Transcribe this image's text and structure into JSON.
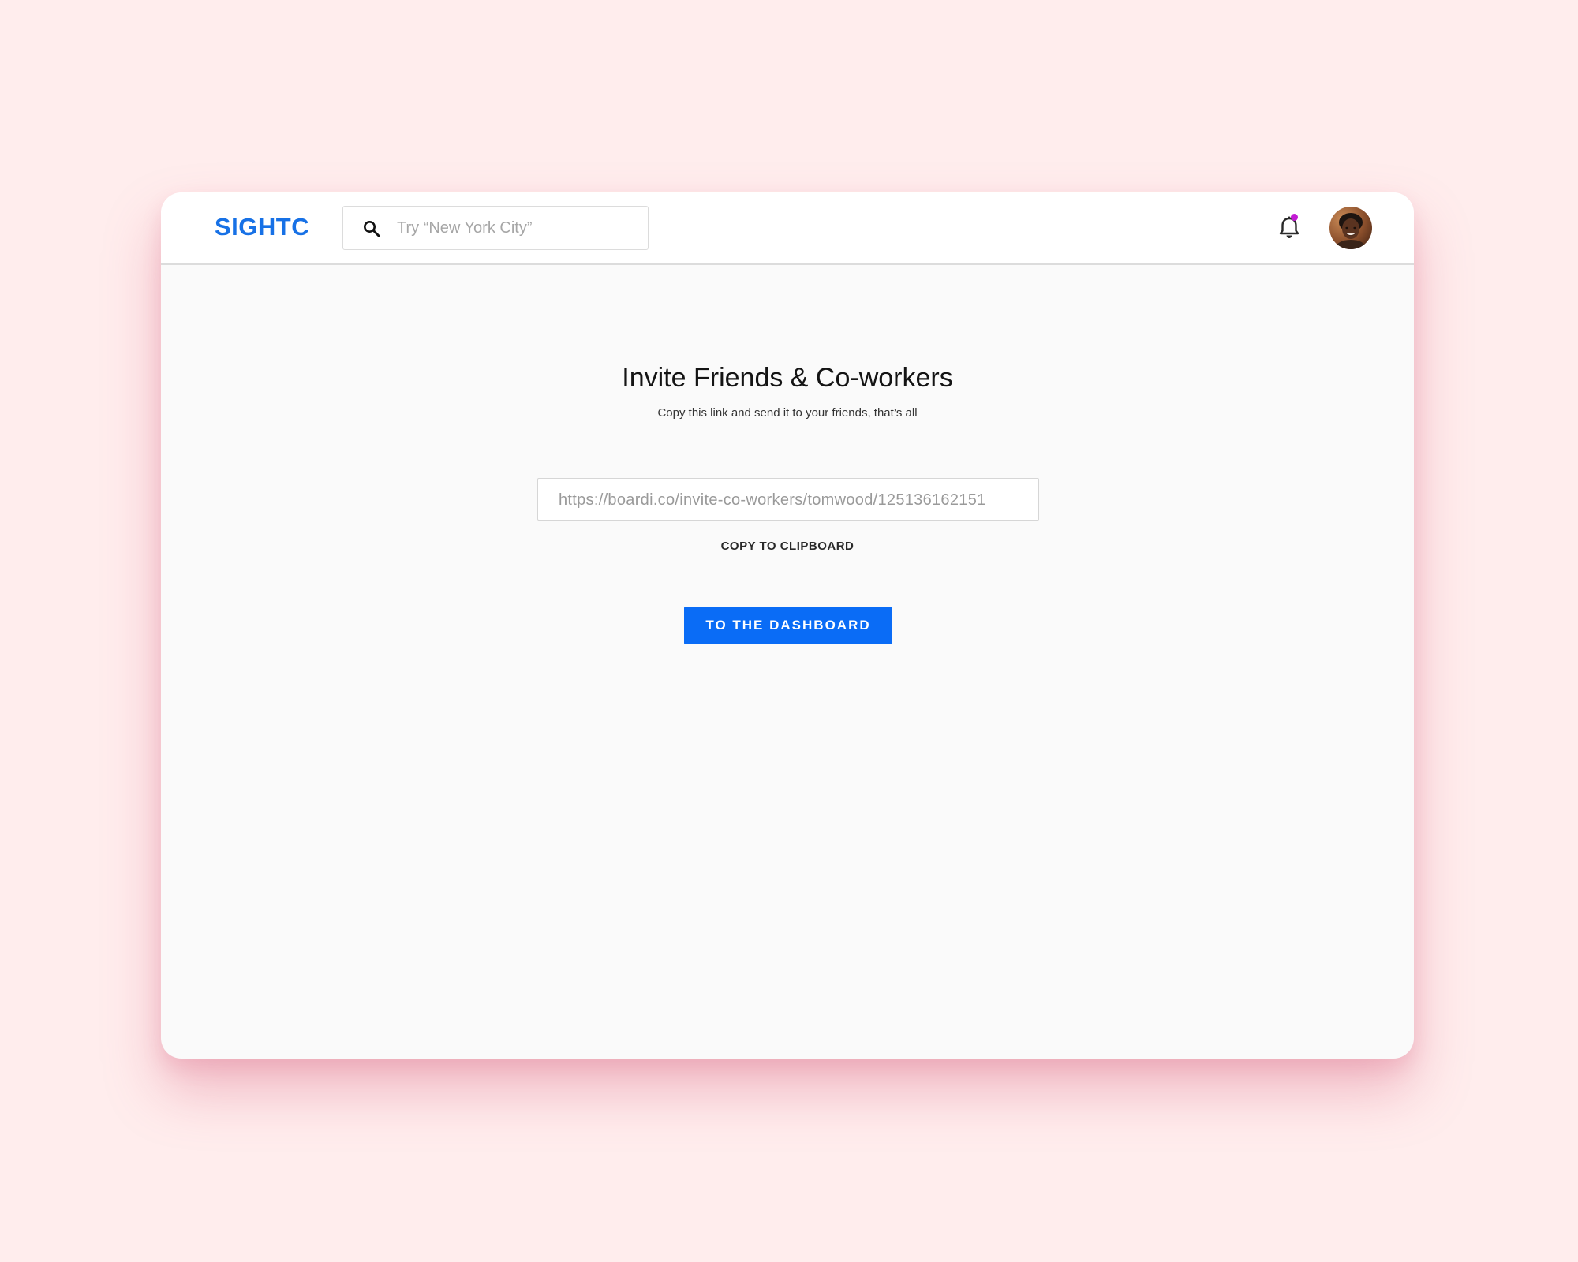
{
  "app": {
    "brand": "SIGHTC"
  },
  "header": {
    "search": {
      "placeholder": "Try “New York City”",
      "value": ""
    },
    "notifications": {
      "has_unread": true,
      "dot_color": "#c31bd4"
    }
  },
  "invite": {
    "title": "Invite Friends & Co-workers",
    "subtitle": "Copy this link and send it to your friends, that’s all",
    "link": "https://boardi.co/invite-co-workers/tomwood/125136162151",
    "copy_label": "COPY TO CLIPBOARD",
    "dashboard_label": "TO THE DASHBOARD"
  },
  "colors": {
    "brand": "#1771e6",
    "primary_button": "#0a6cf6",
    "page_background": "#ffeded"
  },
  "icons": {
    "search": "search-icon",
    "bell": "bell-icon"
  }
}
